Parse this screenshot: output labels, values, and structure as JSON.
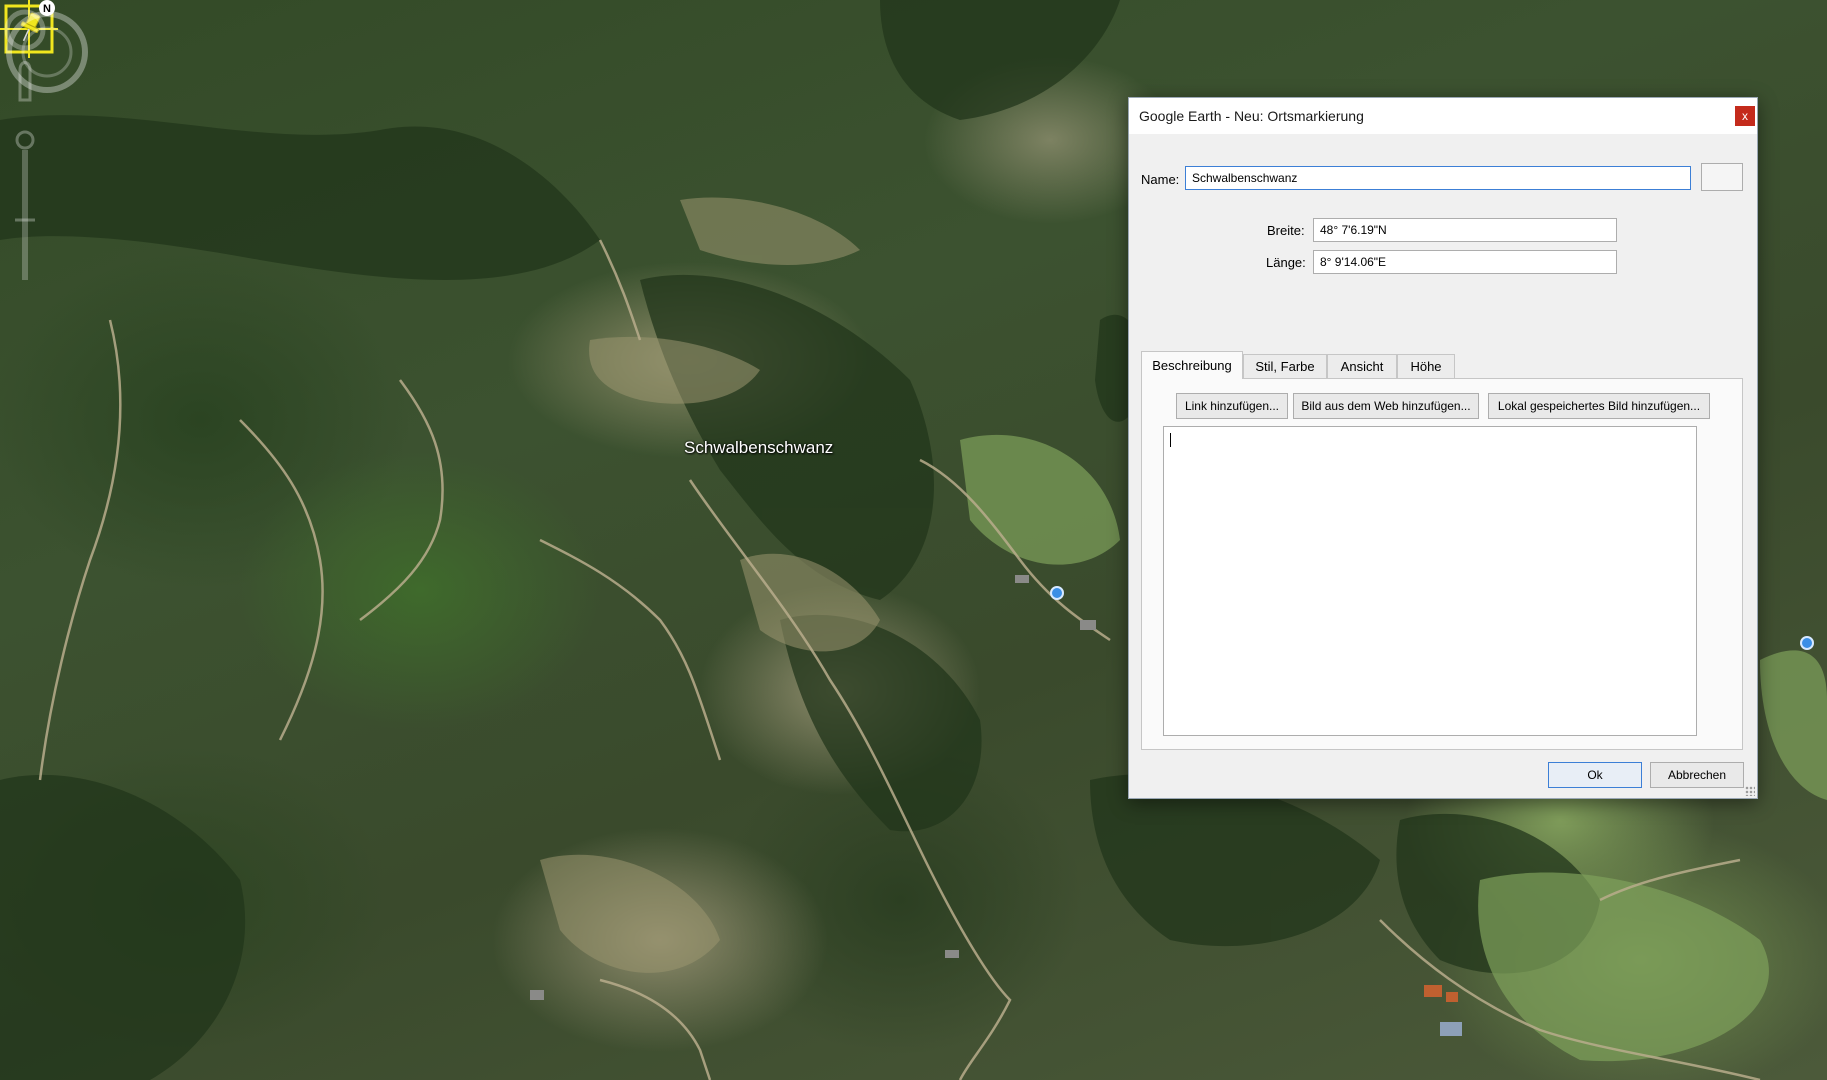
{
  "map": {
    "placemark_label": "Schwalbenschwanz",
    "compass_letter": "N"
  },
  "dialog": {
    "title": "Google Earth - Neu: Ortsmarkierung",
    "close_label": "x",
    "name_label": "Name:",
    "name_value": "Schwalbenschwanz",
    "lat_label": "Breite:",
    "lat_value": "48° 7'6.19\"N",
    "lon_label": "Länge:",
    "lon_value": "8° 9'14.06\"E",
    "tabs": [
      {
        "label": "Beschreibung",
        "active": true
      },
      {
        "label": "Stil, Farbe",
        "active": false
      },
      {
        "label": "Ansicht",
        "active": false
      },
      {
        "label": "Höhe",
        "active": false
      }
    ],
    "buttons": {
      "add_link": "Link hinzufügen...",
      "add_web_image": "Bild aus dem Web hinzufügen...",
      "add_local_image": "Lokal gespeichertes Bild hinzufügen..."
    },
    "description_value": "",
    "ok_label": "Ok",
    "cancel_label": "Abbrechen"
  },
  "colors": {
    "placemark": "#f0e61e",
    "close_button": "#c42b1c",
    "focus_border": "#3c7fd6",
    "marker_blue": "#3a8ee6"
  },
  "icons": {
    "placemark": "yellow-pushpin-icon",
    "compass": "compass-icon",
    "icon_picker": "icon-picker-button"
  }
}
